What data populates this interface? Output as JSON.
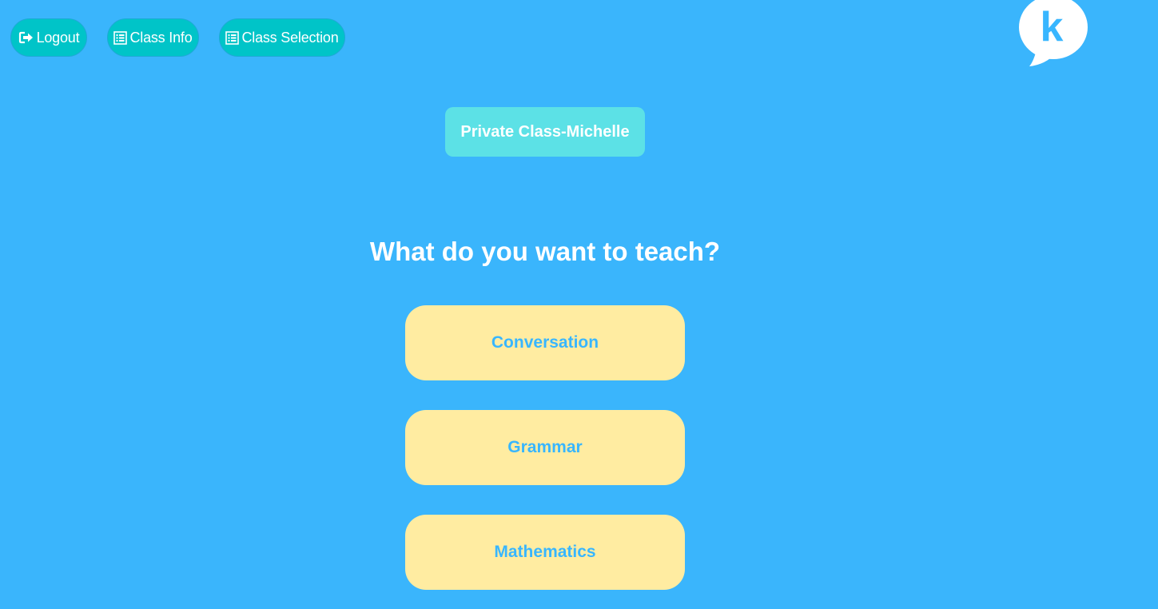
{
  "header": {
    "logout_label": "Logout",
    "class_info_label": "Class Info",
    "class_selection_label": "Class Selection",
    "logo_letter": "k"
  },
  "class_name": "Private Class-Michelle",
  "prompt": "What do you want to teach?",
  "subjects": [
    {
      "label": "Conversation"
    },
    {
      "label": "Grammar"
    },
    {
      "label": "Mathematics"
    }
  ],
  "colors": {
    "background": "#3ab5fc",
    "nav_button": "#00c4c8",
    "class_badge": "#5ce1e6",
    "subject_button": "#ffeca1",
    "subject_text": "#38b6ff"
  },
  "icons": {
    "logout": "sign-out-icon",
    "class_info": "list-icon",
    "class_selection": "list-icon"
  }
}
